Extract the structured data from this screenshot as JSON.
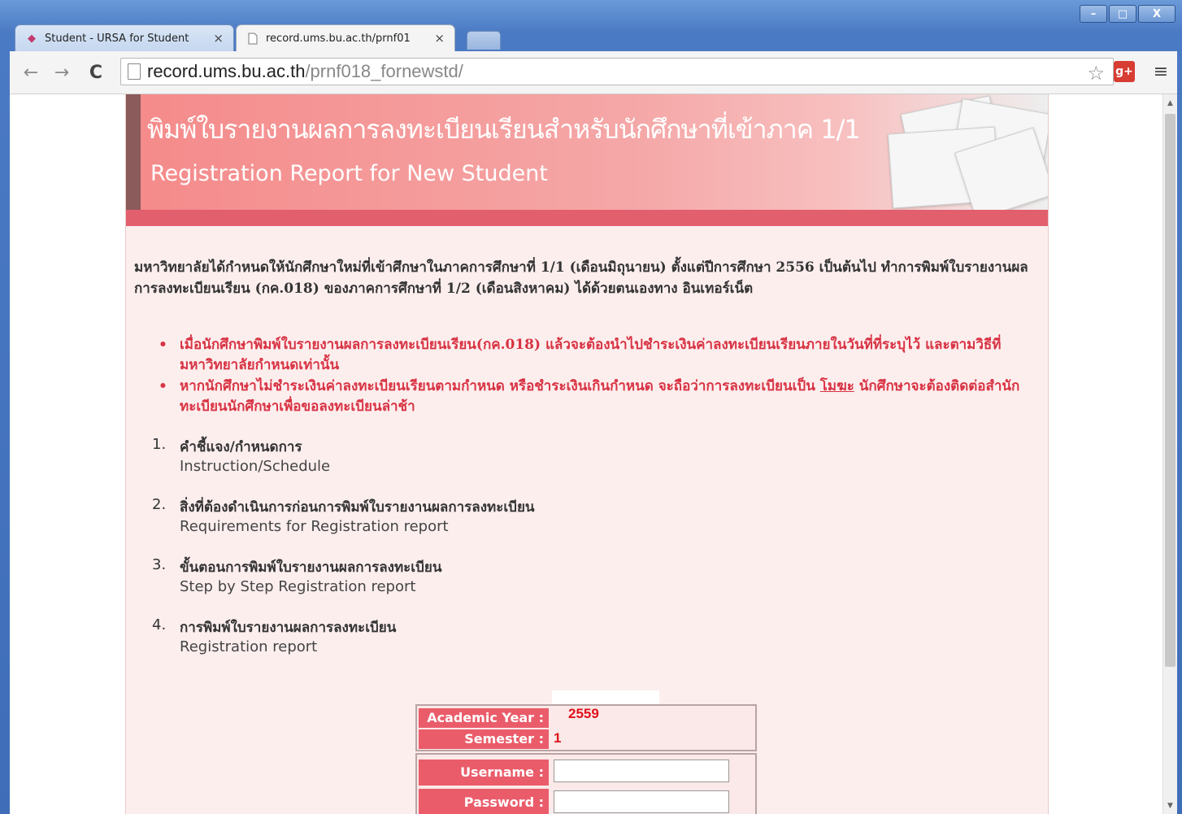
{
  "window": {
    "minimize": "–",
    "maximize": "□",
    "close": "X"
  },
  "tabs": [
    {
      "title": "Student - URSA for Student",
      "close": "×"
    },
    {
      "title": "record.ums.bu.ac.th/prnf01",
      "close": "×"
    }
  ],
  "toolbar": {
    "back": "←",
    "forward": "→",
    "reload": "C",
    "url_host": "record.ums.bu.ac.th",
    "url_path": "/prnf018_fornewstd/",
    "bookmark": "☆",
    "gplus": "g+",
    "menu": "≡"
  },
  "banner": {
    "title_th": "พิมพ์ใบรายงานผลการลงทะเบียนเรียนสำหรับนักศึกษาที่เข้าภาค 1/1",
    "title_en": "Registration Report for New Student"
  },
  "intro": "มหาวิทยาลัยได้กำหนดให้นักศึกษาใหม่ที่เข้าศึกษาในภาคการศึกษาที่ 1/1 (เดือนมิถุนายน) ตั้งแต่ปีการศึกษา 2556 เป็นต้นไป ทำการพิมพ์ใบรายงานผลการลงทะเบียนเรียน (กค.018) ของภาคการศึกษาที่ 1/2 (เดือนสิงหาคม) ได้ด้วยตนเองทาง อินเทอร์เน็ต",
  "warnings": [
    {
      "text": "เมื่อนักศึกษาพิมพ์ใบรายงานผลการลงทะเบียนเรียน(กค.018) แล้วจะต้องนำไปชำระเงินค่าลงทะเบียนเรียนภายในวันที่ที่ระบุไว้ และตามวิธีที่มหาวิทยาลัยกำหนดเท่านั้น"
    },
    {
      "text_before": "หากนักศึกษาไม่ชำระเงินค่าลงทะเบียนเรียนตามกำหนด หรือชำระเงินเกินกำหนด จะถือว่าการลงทะเบียนเป็น ",
      "underlined": "โมฆะ",
      "text_after": " นักศึกษาจะต้องติดต่อสำนักทะเบียนนักศึกษาเพื่อขอลงทะเบียนล่าช้า"
    }
  ],
  "steps": [
    {
      "num": "1.",
      "th": "คำชี้แจง/กำหนดการ",
      "en": "Instruction/Schedule"
    },
    {
      "num": "2.",
      "th": "สิ่งที่ต้องดำเนินการก่อนการพิมพ์ใบรายงานผลการลงทะเบียน",
      "en": "Requirements for Registration report"
    },
    {
      "num": "3.",
      "th": "ขั้นตอนการพิมพ์ใบรายงานผลการลงทะเบียน",
      "en": "Step by Step Registration report"
    },
    {
      "num": "4.",
      "th": "การพิมพ์ใบรายงานผลการลงทะเบียน",
      "en": "Registration report"
    }
  ],
  "form": {
    "academic_year_label": "Academic Year :",
    "academic_year_value": "2559",
    "semester_label": "Semester :",
    "semester_value": "1",
    "username_label": "Username :",
    "password_label": "Password :",
    "username_value": "",
    "password_value": ""
  }
}
